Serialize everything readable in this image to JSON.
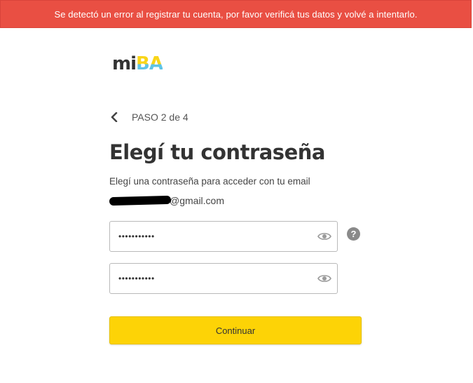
{
  "banner": {
    "error_message": "Se detectó un error al registrar tu cuenta, por favor verificá tus datos y volvé a intentarlo.",
    "color": "#e94f43"
  },
  "logo": {
    "part1": "mi",
    "part2": "BA"
  },
  "step": {
    "back_icon": "chevron-left-icon",
    "label": "PASO 2 de 4"
  },
  "title": "Elegí tu contraseña",
  "subtitle": "Elegí una contraseña para acceder con tu email",
  "email": {
    "visible_part": "@gmail.com",
    "redacted": true
  },
  "fields": {
    "password_value": "•••••••••••",
    "confirm_value": "•••••••••••",
    "toggle_icon": "eye-icon"
  },
  "help_icon": {
    "label": "?"
  },
  "button": {
    "continue_label": "Continuar",
    "color": "#fdd306"
  }
}
